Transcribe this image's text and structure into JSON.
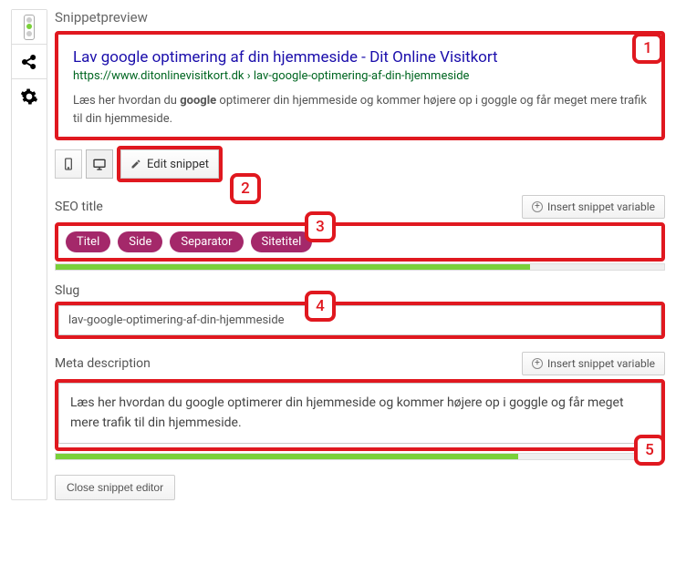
{
  "section_label": "Snippetpreview",
  "preview": {
    "title": "Lav google optimering af din hjemmeside - Dit Online Visitkort",
    "url": "https://www.ditonlinevisitkort.dk › lav-google-optimering-af-din-hjemmeside",
    "desc_pre": "Læs her hvordan du ",
    "desc_bold": "google",
    "desc_post": " optimerer din hjemmeside og kommer højere op i goggle og får meget mere trafik til din hjemmeside."
  },
  "toolbar": {
    "edit_label": "Edit snippet"
  },
  "seo_title": {
    "label": "SEO title",
    "insert_label": "Insert snippet variable",
    "pills": [
      "Titel",
      "Side",
      "Separator",
      "Sitetitel"
    ],
    "progress_pct": 78
  },
  "slug": {
    "label": "Slug",
    "value": "lav-google-optimering-af-din-hjemmeside"
  },
  "meta": {
    "label": "Meta description",
    "insert_label": "Insert snippet variable",
    "value": "Læs her hvordan du google optimerer din hjemmeside og kommer højere op i goggle og får meget mere trafik til din hjemmeside.",
    "progress_pct": 76
  },
  "close_label": "Close snippet editor",
  "markers": [
    "1",
    "2",
    "3",
    "4",
    "5"
  ]
}
